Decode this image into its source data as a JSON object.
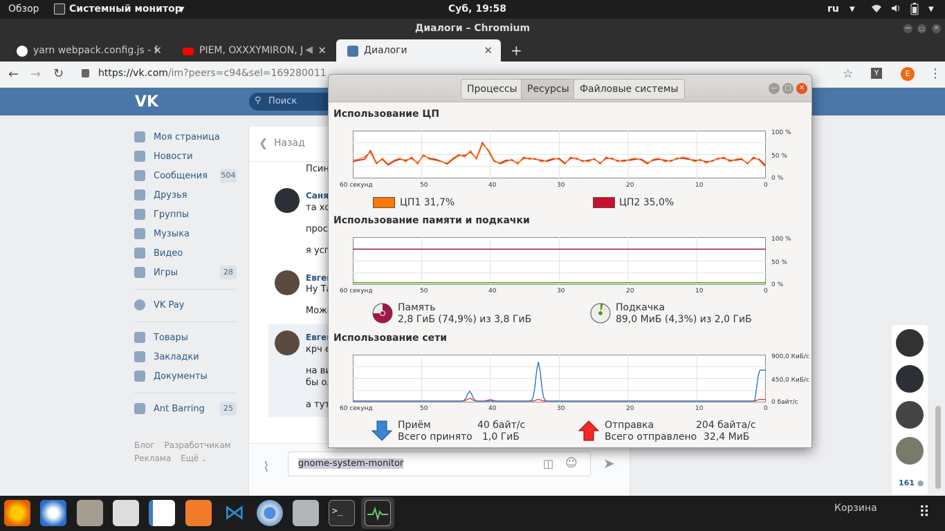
{
  "topbar": {
    "overview": "Обзор",
    "app_name": "Системный монитор",
    "clock": "Суб, 19:58",
    "lang": "ru"
  },
  "browser": {
    "window_title": "Диалоги – Chromium",
    "tabs": [
      {
        "label": "yarn webpack.config.js - f",
        "color": "#ffffff"
      },
      {
        "label": "PIEM, OXXXYMIRON, J",
        "color": "#ff0000"
      },
      {
        "label": "Диалоги",
        "color": "#4a76a8"
      }
    ],
    "url_host": "https://vk.com",
    "url_path": "/im?peers=c94&sel=169280011",
    "ext_y": "Y",
    "ext_e": "E"
  },
  "vk": {
    "search_placeholder": "Поиск",
    "menu": [
      {
        "label": "Моя страница",
        "icon": "home-icon"
      },
      {
        "label": "Новости",
        "icon": "news-icon"
      },
      {
        "label": "Сообщения",
        "icon": "messages-icon",
        "badge": "504"
      },
      {
        "label": "Друзья",
        "icon": "friends-icon"
      },
      {
        "label": "Группы",
        "icon": "groups-icon"
      },
      {
        "label": "Музыка",
        "icon": "music-icon"
      },
      {
        "label": "Видео",
        "icon": "video-icon"
      },
      {
        "label": "Игры",
        "icon": "games-icon",
        "badge": "28"
      },
      {
        "label": "VK Pay",
        "icon": "vkpay-icon"
      },
      {
        "label": "Товары",
        "icon": "goods-icon"
      },
      {
        "label": "Закладки",
        "icon": "bookmarks-icon"
      },
      {
        "label": "Документы",
        "icon": "documents-icon"
      },
      {
        "label": "Ant Barring",
        "icon": "app-icon",
        "badge": "25"
      }
    ],
    "footer": {
      "blog": "Блог",
      "developers": "Разработчикам",
      "ads": "Реклама",
      "more": "Ещё"
    },
    "chat": {
      "back": "Назад",
      "messages": [
        {
          "author": "",
          "text": "Псин"
        },
        {
          "author": "Саня",
          "text": "та хот"
        },
        {
          "author": "",
          "text": "прост"
        },
        {
          "author": "",
          "text": "я успе"
        },
        {
          "author": "Евген",
          "text": "Ну Та"
        },
        {
          "author": "",
          "text": "Може"
        },
        {
          "author": "Евген",
          "text": "крч е"
        },
        {
          "author": "",
          "text": "на ви"
        },
        {
          "author": "",
          "text": "бы ол"
        },
        {
          "author": "",
          "text": "а тут"
        }
      ],
      "input_value": "gnome-system-monitor"
    },
    "online_count": "161"
  },
  "sysmon": {
    "tabs": [
      "Процессы",
      "Ресурсы",
      "Файловые системы"
    ],
    "cpu": {
      "title": "Использование ЦП",
      "y_labels": [
        "100 %",
        "50 %",
        "0 %"
      ],
      "x_labels": [
        "60 секунд",
        "50",
        "40",
        "30",
        "20",
        "10",
        "0"
      ],
      "cpu1_label": "ЦП1 31,7%",
      "cpu2_label": "ЦП2 35,0%",
      "cpu1_color": "#ff7800",
      "cpu2_color": "#c8102e",
      "cpu1_series": [
        38,
        40,
        45,
        55,
        30,
        42,
        30,
        38,
        42,
        35,
        45,
        30,
        50,
        40,
        38,
        35,
        32,
        42,
        50,
        45,
        58,
        40,
        72,
        60,
        38,
        30,
        35,
        40,
        30,
        45,
        40,
        42,
        35,
        38,
        42,
        40,
        30,
        45,
        40,
        38,
        35,
        42,
        30,
        45,
        40,
        38,
        35,
        40,
        42,
        38,
        30,
        40,
        42,
        35,
        38,
        40,
        45,
        42,
        35,
        40,
        32,
        38,
        40,
        45,
        35,
        40,
        42,
        30,
        45,
        38,
        25
      ],
      "cpu2_series": [
        35,
        38,
        40,
        58,
        32,
        40,
        28,
        36,
        40,
        38,
        42,
        32,
        48,
        42,
        40,
        36,
        30,
        40,
        48,
        48,
        55,
        42,
        75,
        58,
        36,
        32,
        38,
        38,
        32,
        42,
        42,
        40,
        38,
        36,
        40,
        42,
        32,
        42,
        42,
        36,
        38,
        40,
        32,
        42,
        42,
        36,
        38,
        38,
        40,
        40,
        32,
        38,
        40,
        38,
        36,
        42,
        42,
        40,
        38,
        38,
        35,
        36,
        42,
        42,
        38,
        38,
        40,
        32,
        42,
        40,
        28
      ]
    },
    "memory": {
      "title": "Использование памяти и подкачки",
      "y_labels": [
        "100 %",
        "50 %",
        "0 %"
      ],
      "x_labels": [
        "60 секунд",
        "50",
        "40",
        "30",
        "20",
        "10",
        "0"
      ],
      "mem_percent": 74.9,
      "swap_percent": 4.3,
      "mem_color": "#a0174a",
      "swap_color": "#4e9a06",
      "mem_label": "Память",
      "mem_value": "2,8 ГиБ (74,9%) из 3,8 ГиБ",
      "swap_label": "Подкачка",
      "swap_value": "89,0 МиБ (4,3%) из 2,0 ГиБ"
    },
    "network": {
      "title": "Использование сети",
      "y_labels": [
        "900,0 КиБ/с",
        "450,0 КиБ/с",
        "0 байт/с"
      ],
      "x_labels": [
        "60 секунд",
        "50",
        "40",
        "30",
        "20",
        "10",
        "0"
      ],
      "recv_color": "#1f6fbf",
      "send_color": "#ef2929",
      "recv_series": [
        0,
        0,
        0,
        0,
        0,
        0,
        0,
        0,
        0,
        0,
        0,
        0,
        0,
        0,
        0,
        0,
        0,
        0,
        0,
        0,
        0,
        0,
        0,
        0,
        0,
        0,
        0,
        0,
        0,
        0,
        0,
        0,
        0,
        0,
        0,
        0,
        0,
        0,
        0,
        0,
        0,
        0,
        0,
        0,
        0,
        0,
        0,
        0,
        0,
        0,
        0,
        0,
        0,
        0,
        0,
        0,
        0,
        0,
        0,
        0,
        0,
        0,
        0,
        0,
        0,
        0,
        0,
        0,
        0,
        0,
        0,
        0,
        0,
        0,
        0,
        0,
        0,
        0,
        0,
        0,
        0,
        0,
        0,
        0,
        0,
        0,
        0,
        0,
        0,
        0,
        0,
        0,
        0,
        0,
        0,
        0,
        0,
        0,
        0,
        0,
        0,
        0,
        0,
        0,
        0,
        0,
        0,
        0,
        0,
        0,
        0,
        0,
        0,
        0,
        0,
        0,
        0,
        0,
        0,
        0
      ],
      "recv_peaks": [
        {
          "t": 43,
          "v": 190
        },
        {
          "t": 33,
          "v": 760
        },
        {
          "t": 0.5,
          "v": 600
        }
      ],
      "send_peaks": [
        {
          "t": 43,
          "v": 50
        },
        {
          "t": 40,
          "v": 25
        },
        {
          "t": 33,
          "v": 30
        },
        {
          "t": 0.5,
          "v": 30
        }
      ],
      "recv_label": "Приём",
      "recv_rate": "40 байт/с",
      "recv_total_label": "Всего принято",
      "recv_total": "1,0 ГиБ",
      "send_label": "Отправка",
      "send_rate": "204 байта/с",
      "send_total_label": "Всего отправлено",
      "send_total": "32,4 МиБ"
    }
  },
  "taskbar": {
    "apps": [
      "firefox-icon",
      "thunderbird-icon",
      "files-icon",
      "disks-icon",
      "writer-icon",
      "software-icon",
      "vscode-icon",
      "chromium-icon",
      "settings-icon",
      "terminal-icon",
      "sysmon-icon"
    ],
    "trash_label": "Корзина"
  }
}
